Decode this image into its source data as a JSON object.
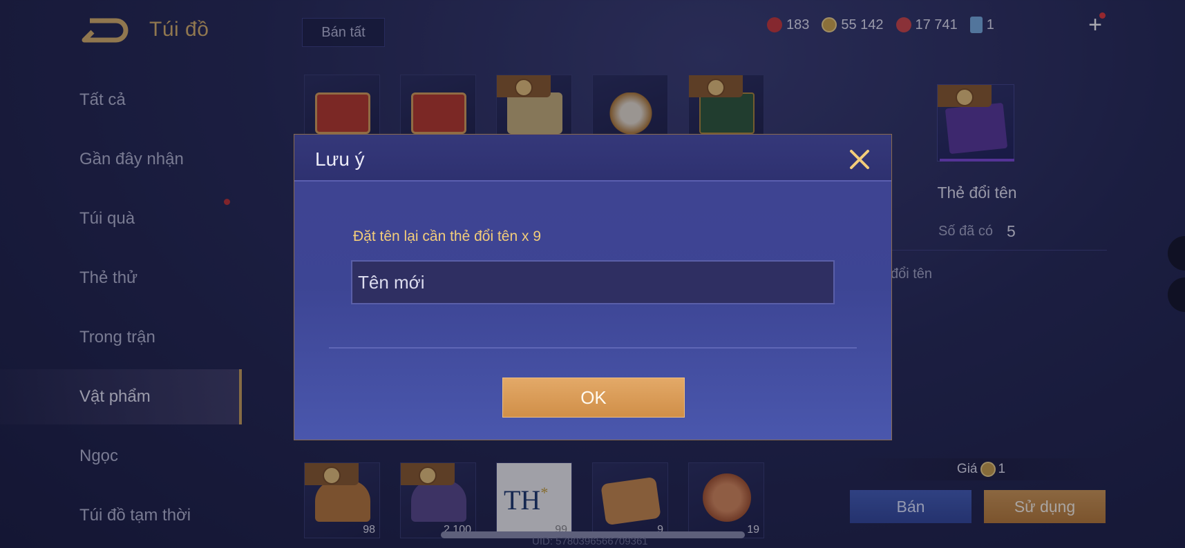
{
  "header": {
    "title": "Túi đồ",
    "sell_all_label": "Bán tất",
    "currencies": [
      {
        "icon": "red-gem-icon",
        "value": "183",
        "color": "#c83a3a"
      },
      {
        "icon": "gold-coin-icon",
        "value": "55 142",
        "color": "#d2a84a"
      },
      {
        "icon": "ruby-icon",
        "value": "17 741",
        "color": "#d04848"
      },
      {
        "icon": "ticket-icon",
        "value": "1",
        "color": "#7ab0e0"
      }
    ]
  },
  "sidebar": {
    "items": [
      {
        "label": "Tất cả"
      },
      {
        "label": "Gần đây nhận"
      },
      {
        "label": "Túi quà"
      },
      {
        "label": "Thẻ thử"
      },
      {
        "label": "Trong trận"
      },
      {
        "label": "Vật phẩm"
      },
      {
        "label": "Ngọc"
      },
      {
        "label": "Túi đồ tạm thời"
      }
    ],
    "active_index": 5
  },
  "grid": {
    "bottom_counts": [
      "98",
      "2 100",
      "99",
      "9",
      "19"
    ]
  },
  "detail": {
    "name": "Thẻ đổi tên",
    "owned_label": "Số đã có",
    "owned_value": "5",
    "description": "đổi tên",
    "price_label": "Giá",
    "price_value": "1",
    "sell_label": "Bán",
    "use_label": "Sử dụng"
  },
  "footer": {
    "uid": "UID: 5780396566709361"
  },
  "modal": {
    "title": "Lưu ý",
    "message": "Đặt tên lại cần thẻ đổi tên x 9",
    "input_placeholder": "Tên mới",
    "ok_label": "OK"
  },
  "colors": {
    "accent_gold": "#d9b36a",
    "modal_bg": "#3f4391",
    "ok_button": "#d8a05a",
    "sell_button": "#3d55a8"
  }
}
